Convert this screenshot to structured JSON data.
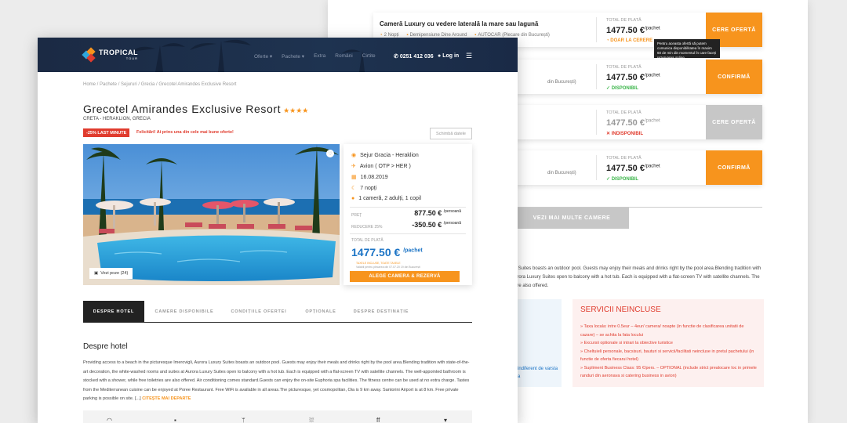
{
  "back_window": {
    "rooms": [
      {
        "name": "Cameră Luxury cu vedere laterală la mare sau lagună",
        "meta": [
          "2 Nopți",
          "Demipensiune Dine Around",
          "AUTOCAR (Plecare din București)"
        ],
        "total_label": "TOTAL DE PLATĂ",
        "price": "1477.50 €",
        "price_unit": "/pachet",
        "status": "DOAR LA CERERE",
        "status_color": "#f7941d",
        "cta": "CERE OFERTĂ",
        "disabled": false
      },
      {
        "name": "",
        "meta": [
          "",
          "",
          "din București)"
        ],
        "total_label": "TOTAL DE PLATĂ",
        "price": "1477.50 €",
        "price_unit": "/pachet",
        "status": "DISPONIBIL",
        "status_color": "#3bb54a",
        "cta": "CONFIRMĂ",
        "disabled": false
      },
      {
        "name": "",
        "meta": [
          "",
          "",
          ""
        ],
        "total_label": "TOTAL DE PLATĂ",
        "price": "1477.50 €",
        "price_unit": "/pachet",
        "status": "INDISPONIBIL",
        "status_color": "#e03c2e",
        "cta": "CERE OFERTĂ",
        "disabled": true
      },
      {
        "name": "",
        "meta": [
          "",
          "",
          "din București)"
        ],
        "total_label": "TOTAL DE PLATĂ",
        "price": "1477.50 €",
        "price_unit": "/pachet",
        "status": "DISPONIBIL",
        "status_color": "#3bb54a",
        "cta": "CONFIRMĂ",
        "disabled": false
      }
    ],
    "tooltip": "Pentru aceasta ofertă să putem comunica disponibilitatea în maxim 60 de min din momentul în care faceți rezervarea online.",
    "more_rooms": "VEZI MAI MULTE CAMERE",
    "desc_lines": [
      "y Suites boasts an outdoor pool. Guests may enjoy their meals and drinks right by the pool area.Blending tradition with",
      "urora Luxury Suites open to balcony with a hot tub. Each is equipped with a flat-screen TV with satellite channels. The",
      "are also offered."
    ],
    "included_fragment": [
      "indiferent de varsta",
      "a"
    ],
    "excluded_title": "SERVICII NEINCLUSE",
    "excluded_items": [
      "» Taxa locala: intre 0.5eur – 4eur/ camera/ noapte (in functie de clasificarea unitatii de cazare) – se achita la fata locului",
      "» Excursii optionale si intrari la obiective turistice",
      "» Cheltuieli personale, bacsisuri, bauturi si servicii/facilitati neincluse in pretul pachetului (in functie de oferta fiecarui hotel)",
      "» Supliment Business Class: 95 €/pers. – OPTIONAL (include strict prealocare loc in primele randuri din aeronava si catering business in avion)"
    ]
  },
  "header": {
    "logo_main": "TROPICAL",
    "logo_sub": "TOUR",
    "menu": [
      "Oferte",
      "Pachete",
      "Extra",
      "Români",
      "Cirtite"
    ],
    "phone": "0251 412 036",
    "login": "Log in"
  },
  "page": {
    "breadcrumb": "Home / Pachete / Sejururi / Grecia / Grecotel Amirandes Exclusive Resort",
    "title": "Grecotel Amirandes Exclusive Resort",
    "stars": "★★★★",
    "location": "CRETA - HERAKLION, GRECIA",
    "badge": "-25% LAST MINUTE",
    "congrats": "Felicitări! Ai prins una din cele mai bune oferte!",
    "change_date": "Schimbă datele",
    "photos_button": "Vezi poze (24)"
  },
  "offer": {
    "trip": "Sejur Gracia - Heraklion",
    "flight": "Avion ( OTP > HER )",
    "date": "16.08.2019",
    "nights": "7 nopți",
    "guests": "1 cameră, 2 adulți, 1 copil",
    "price_label": "PREȚ",
    "price": "877.50 €",
    "price_unit": "/persoană",
    "discount_label": "REDUCERE 25%",
    "discount": "-350.50 €",
    "discount_unit": "/persoană",
    "total_label": "TOTAL DE PLATĂ",
    "total": "1477.50 €",
    "total_unit": "/pachet",
    "tax_note": "TAXELE INCLUSE, TOATE TAXELE",
    "tax_sub": "Valabil pentru plecarea din 07.07.20 19 din București",
    "book": "ALEGE CAMERA & REZERVĂ"
  },
  "tabs": [
    "DESPRE HOTEL",
    "CAMERE DISPONIBILE",
    "CONDIȚIILE OFERTEI",
    "OPȚIONALE",
    "DESPRE DESTINAȚIE"
  ],
  "about": {
    "title": "Despre hotel",
    "text": "Providing access to a beach in the picturesque Imerovigli, Aurora Luxury Suites boasts an outdoor pool. Guests may enjoy their meals and drinks right by the pool area.Blending tradition with state-of-the-art decoration, the white-washed rooms and suites at Aurora Luxury Suites open to balcony with a hot tub. Each is equipped with a flat-screen TV with satellite channels. The well-appointed bathroom is stocked with a shower, while free toiletries are also offered. Air conditioning comes standard.Guests can enjoy the on-site Euphoria spa facilities. The fitness centre can be used at no extra charge. Tastes from the Mediterranean cuisine can be enjoyed at Poree Restaurant. Free WiFi is available in all areas.The picturesque, yet cosmopolitan, Oia is 9 km  away. Santorini Airport is at 8 km. Free private parking is possible on site. [...]",
    "read_more": "CITEȘTE MAI DEPARTE"
  },
  "facility_icons": [
    "wifi-icon",
    "parking-icon",
    "restaurant-icon",
    "pool-icon",
    "fitness-icon",
    "bar-icon"
  ]
}
